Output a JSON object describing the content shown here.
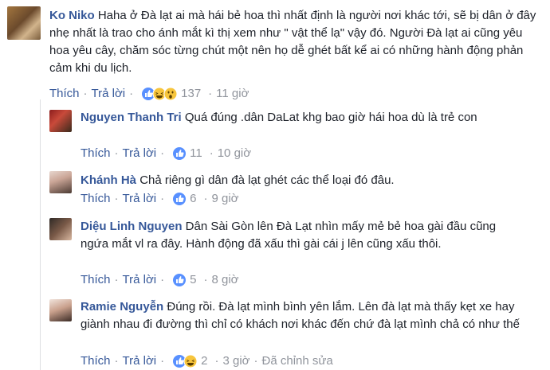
{
  "comments": [
    {
      "author": "Ko Niko",
      "text": "Haha ở Đà lạt ai mà hái bẻ hoa thì nhất định là người nơi khác tới, sẽ bị dân ở đây nhẹ nhất là trao cho ánh mắt kì thị xem như \" vật thể lạ\" vậy đó. Người Đà lạt ai cũng yêu hoa yêu cây, chăm sóc từng chút một nên họ dễ ghét bất kể ai có những hành động phản cảm khi du lịch.",
      "like_label": "Thích",
      "reply_label": "Trả lời",
      "reaction_icons": [
        "like-icon",
        "haha-icon",
        "wow-icon"
      ],
      "reaction_count": "137",
      "time": "11 giờ"
    },
    {
      "author": "Nguyen Thanh Tri",
      "text": "Quá đúng .dân DaLat khg bao giờ hái hoa dù là trẻ con",
      "like_label": "Thích",
      "reply_label": "Trả lời",
      "reaction_icons": [
        "like-icon"
      ],
      "reaction_count": "11",
      "time": "10 giờ"
    },
    {
      "author": "Khánh Hà",
      "text": "Chả riêng gì dân đà lạt ghét các thể loại đó đâu.",
      "like_label": "Thích",
      "reply_label": "Trả lời",
      "reaction_icons": [
        "like-icon"
      ],
      "reaction_count": "6",
      "time": "9 giờ"
    },
    {
      "author": "Diệu Linh Nguyen",
      "text": "Dân Sài Gòn lên Đà Lạt nhìn mấy mẻ bẻ hoa gài đầu cũng ngứa mắt vl ra đây. Hành động đã xấu thì gài cái j lên cũng xấu thôi.",
      "like_label": "Thích",
      "reply_label": "Trả lời",
      "reaction_icons": [
        "like-icon"
      ],
      "reaction_count": "5",
      "time": "8 giờ"
    },
    {
      "author": "Ramie Nguyễn",
      "text": "Đúng rồi. Đà lạt mình bình yên lắm. Lên đà lạt mà thấy kẹt xe hay giành nhau đi đường thì chỉ có khách nơi khác đến chứ đà lạt mình chả có như thế",
      "like_label": "Thích",
      "reply_label": "Trả lời",
      "reaction_icons": [
        "like-icon",
        "haha-icon"
      ],
      "reaction_count": "2",
      "time": "3 giờ",
      "edited_label": "Đã chỉnh sửa"
    }
  ],
  "colors": {
    "link": "#365899",
    "meta": "#90949c",
    "text": "#1d2129",
    "like_blue": "#5890ff",
    "haha_yellow": "#f7c53c"
  }
}
